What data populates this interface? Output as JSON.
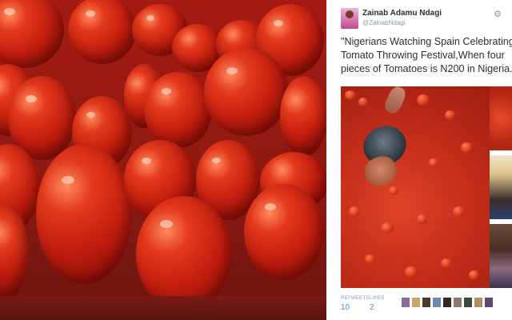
{
  "tweet": {
    "display_name": "Zainab Adamu Ndagi",
    "handle": "@ZainabNdagi",
    "text": "\"Nigerians Watching Spain Celebrating Tomato Throwing Festival,When four pieces of Tomatoes is N200 in Nigeria. \"",
    "retweets_label": "RETWEETS",
    "retweets_count": "10",
    "likes_label": "LIKES",
    "likes_count": "2"
  },
  "icons": {
    "settings": "gear-icon"
  },
  "colors": {
    "link_blue": "#3b94d9",
    "meta_gray": "#8899a6",
    "text_dark": "#292f33",
    "tomato_red": "#c01d0e"
  }
}
